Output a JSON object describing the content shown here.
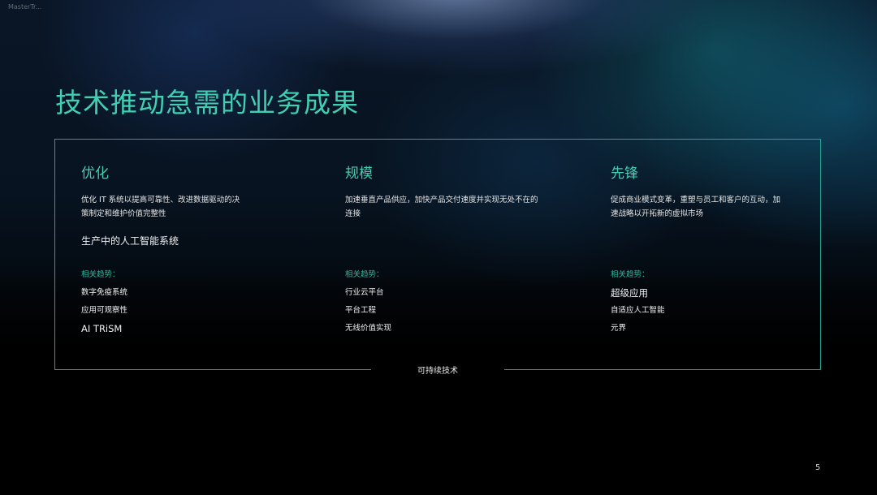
{
  "watermark": "MasterTr...",
  "title": "技术推动急需的业务成果",
  "columns": [
    {
      "heading": "优化",
      "desc_line1": "优化 IT 系统以提高可靠性、改进数据驱动的决",
      "desc_line2": "策制定和维护价值完整性",
      "sub": "生产中的人工智能系统",
      "trends_label": "相关趋势：",
      "trends": [
        "数字免疫系统",
        "应用可观察性",
        "AI TRiSM"
      ]
    },
    {
      "heading": "规模",
      "desc_line1": "加速垂直产品供应，加快产品交付速度并实现无处不在的",
      "desc_line2": "连接",
      "sub": "",
      "trends_label": "相关趋势：",
      "trends": [
        "行业云平台",
        "平台工程",
        "无线价值实现"
      ]
    },
    {
      "heading": "先锋",
      "desc_line1": "促成商业模式变革，重塑与员工和客户的互动，加",
      "desc_line2": "速战略以开拓新的虚拟市场",
      "sub": "",
      "trends_label": "相关趋势：",
      "trends": [
        "超级应用",
        "自适应人工智能",
        "元界"
      ]
    }
  ],
  "footer_label": "可持续技术",
  "page_number": "5",
  "colors": {
    "accent": "#3fd0b4",
    "frame": "#1fa391",
    "background": "#000000"
  }
}
